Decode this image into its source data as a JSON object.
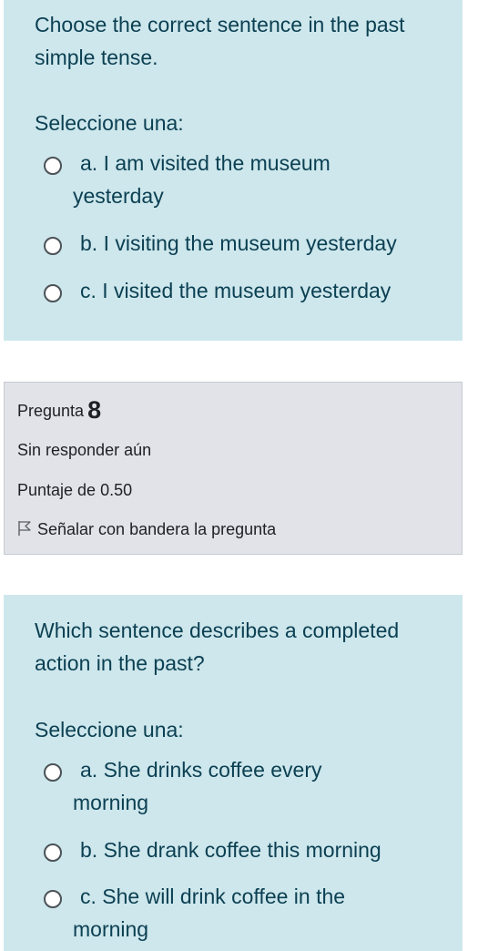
{
  "question1": {
    "text": "Choose the correct sentence in the past simple tense.",
    "prompt": "Seleccione una:",
    "options": [
      {
        "line1": "a. I am visited the museum",
        "line2": "yesterday"
      },
      {
        "line1": "b. I visiting the museum yesterday"
      },
      {
        "line1": "c. I visited the museum yesterday"
      }
    ]
  },
  "info": {
    "question_label": "Pregunta",
    "question_number": "8",
    "state": "Sin responder aún",
    "grade": "Puntaje de 0.50",
    "flag_label": "Señalar con bandera la pregunta",
    "flag_icon": "flag-outline-icon"
  },
  "question2": {
    "text": "Which sentence describes a completed action in the past?",
    "prompt": "Seleccione una:",
    "options": [
      {
        "line1": "a. She drinks coffee every",
        "line2": "morning"
      },
      {
        "line1": "b. She drank coffee this morning"
      },
      {
        "line1": "c. She will drink coffee in the",
        "line2": "morning"
      }
    ]
  },
  "colors": {
    "question_bg": "#cde7ec",
    "question_text": "#0b3f52",
    "info_bg": "#e1e3e8"
  }
}
